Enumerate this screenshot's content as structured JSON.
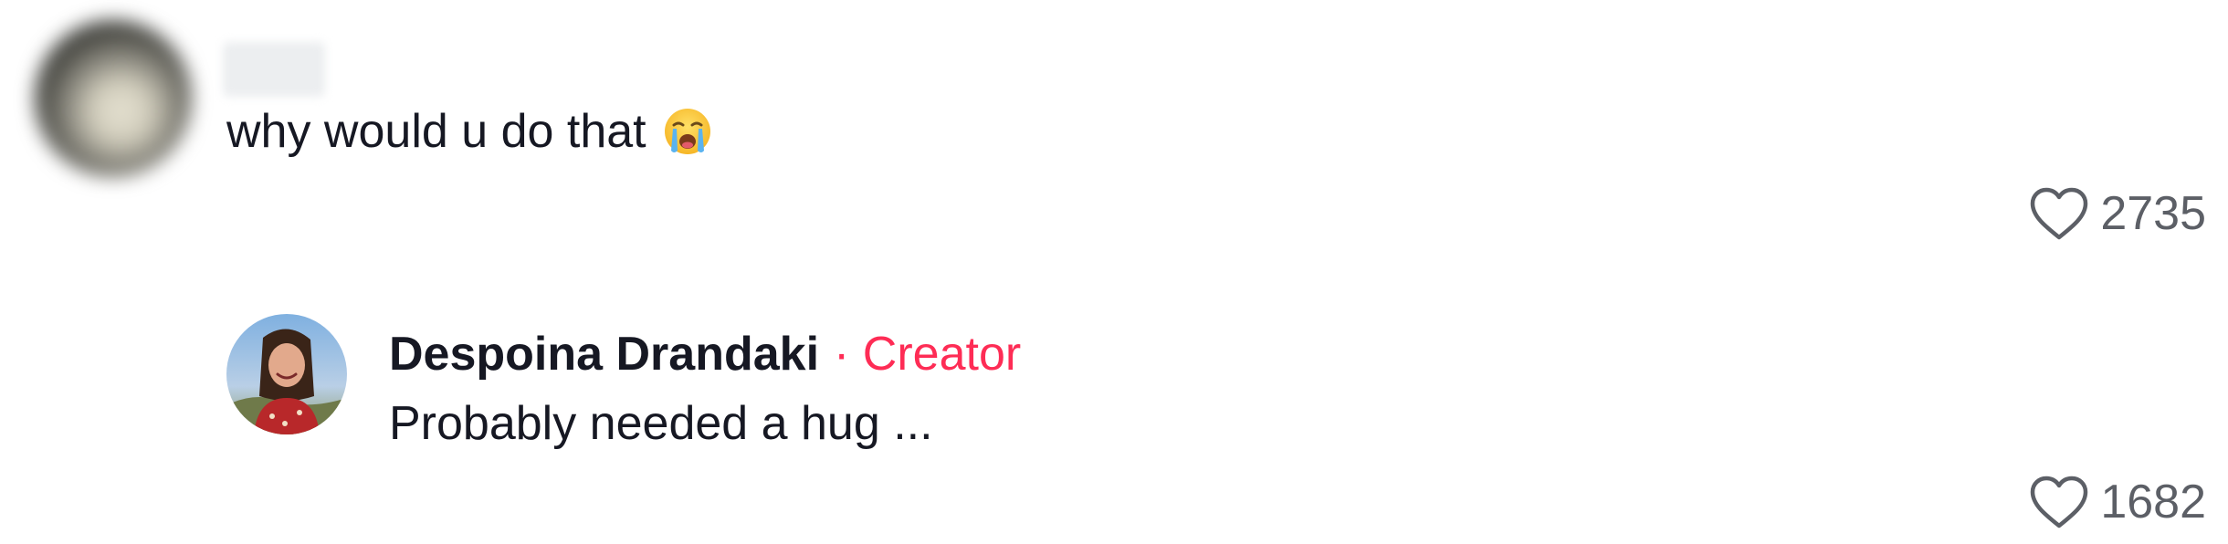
{
  "comment": {
    "username": "",
    "text": "why would u do that",
    "emoji_icon": "loudly-crying-face-icon",
    "likes": "2735"
  },
  "reply": {
    "author": "Despoina Drandaki",
    "creator_label": "· Creator",
    "text": "Probably needed a hug ...",
    "likes": "1682"
  },
  "colors": {
    "text_primary": "#161823",
    "creator_accent": "#fe2c55",
    "like_count": "#5c5f66"
  }
}
